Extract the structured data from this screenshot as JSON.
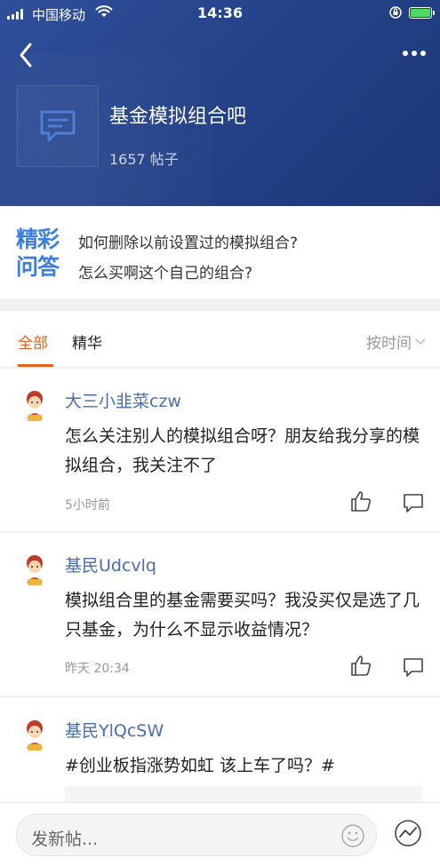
{
  "status_bar": {
    "carrier": "中国移动",
    "time": "14:36"
  },
  "bar": {
    "title": "基金模拟组合吧",
    "post_count": "1657 帖子"
  },
  "qa": {
    "badge_line1": "精彩",
    "badge_line2": "问答",
    "questions": [
      "如何删除以前设置过的模拟组合?",
      "怎么买啊这个自己的组合?"
    ]
  },
  "tabs": {
    "all": "全部",
    "featured": "精华",
    "sort": "按时间"
  },
  "posts": [
    {
      "user": "大三小韭菜czw",
      "text": "怎么关注别人的模拟组合呀？朋友给我分享的模拟组合，我关注不了",
      "time": "5小时前"
    },
    {
      "user": "基民Udcvlq",
      "text": "模拟组合里的基金需要买吗？我没买仅是选了几只基金，为什么不显示收益情况？",
      "time": "昨天 20:34"
    },
    {
      "user": "基民YlQcSW",
      "text": "#创业板指涨势如虹 该上车了吗？#",
      "time": ""
    }
  ],
  "composer": {
    "placeholder": "发新帖..."
  },
  "icons": {
    "back": "chevron-left-icon",
    "more": "more-dots-icon",
    "forum": "chat-bubble-icon",
    "like": "thumb-up-icon",
    "comment": "comment-icon",
    "emoji": "smiley-icon",
    "trend": "trend-chart-icon"
  },
  "colors": {
    "header": "#2a4a92",
    "accent": "#e2621f",
    "username": "#4a6cb0",
    "badge": "#3d7fe0"
  }
}
